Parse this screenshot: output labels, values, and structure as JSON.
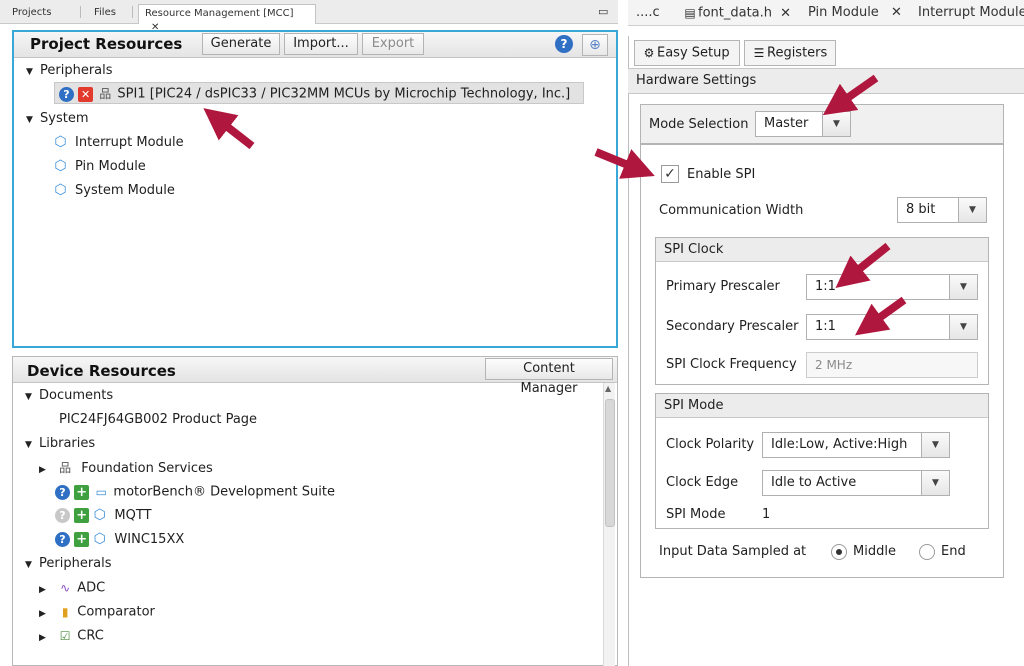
{
  "top_tabs_left": [
    "Projects",
    "Files",
    "Resource Management [MCC]",
    "✕"
  ],
  "top_tabs_right": [
    "....c",
    "font_data.h",
    "✕",
    "Pin Module",
    "✕",
    "Interrupt Module"
  ],
  "minimize_glyph": "▭",
  "project_resources": {
    "title": "Project Resources",
    "buttons": {
      "generate": "Generate",
      "import": "Import...",
      "export": "Export"
    },
    "tree": {
      "peripherals_label": "Peripherals",
      "spi_item": "SPI1 [PIC24 / dsPIC33 / PIC32MM MCUs by Microchip Technology, Inc.]",
      "system_label": "System",
      "system_items": [
        "Interrupt Module",
        "Pin Module",
        "System Module"
      ]
    }
  },
  "device_resources": {
    "title": "Device Resources",
    "content_manager_label": "Content Manager",
    "tree": {
      "documents_label": "Documents",
      "product_page": "PIC24FJ64GB002 Product Page",
      "libraries_label": "Libraries",
      "libraries": [
        "Foundation Services",
        "motorBench® Development Suite",
        "MQTT",
        "WINC15XX"
      ],
      "peripherals_label": "Peripherals",
      "peripherals": [
        "ADC",
        "Comparator",
        "CRC"
      ]
    }
  },
  "setup_tabs": {
    "easy_setup": "Easy Setup",
    "registers": "Registers"
  },
  "hardware_settings": {
    "title": "Hardware Settings",
    "mode_selection_label": "Mode Selection",
    "mode_value": "Master",
    "enable_spi_label": "Enable SPI",
    "comm_width_label": "Communication Width",
    "comm_width_value": "8 bit",
    "spi_clock": {
      "title": "SPI Clock",
      "primary_label": "Primary Prescaler",
      "primary_value": "1:1",
      "secondary_label": "Secondary Prescaler",
      "secondary_value": "1:1",
      "freq_label": "SPI Clock Frequency",
      "freq_value": "2 MHz"
    },
    "spi_mode": {
      "title": "SPI Mode",
      "polarity_label": "Clock Polarity",
      "polarity_value": "Idle:Low, Active:High",
      "edge_label": "Clock Edge",
      "edge_value": "Idle to Active",
      "mode_label": "SPI Mode",
      "mode_value": "1"
    },
    "sampled_label": "Input Data Sampled at",
    "sample_middle": "Middle",
    "sample_end": "End"
  },
  "colors": {
    "accent_border": "#39a8d8",
    "annotation_arrow": "#b0173e"
  }
}
